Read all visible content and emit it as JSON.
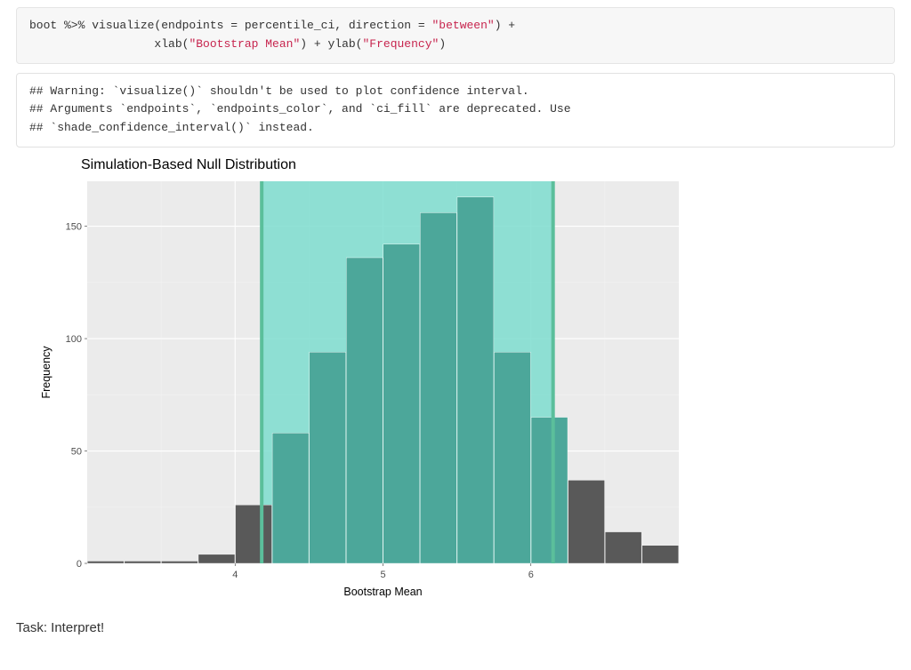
{
  "code": {
    "line1_a": "boot %>% visualize(endpoints = percentile_ci, direction = ",
    "line1_b": "\"between\"",
    "line1_c": ") +",
    "line2_a": "                  xlab(",
    "line2_b": "\"Bootstrap Mean\"",
    "line2_c": ") + ylab(",
    "line2_d": "\"Frequency\"",
    "line2_e": ")"
  },
  "warning": {
    "line1": "## Warning: `visualize()` shouldn't be used to plot confidence interval.",
    "line2": "## Arguments `endpoints`, `endpoints_color`, and `ci_fill` are deprecated. Use",
    "line3": "## `shade_confidence_interval()` instead."
  },
  "chart_data": {
    "type": "bar",
    "title": "Simulation-Based Null Distribution",
    "xlabel": "Bootstrap Mean",
    "ylabel": "Frequency",
    "x_ticks": [
      4,
      5,
      6
    ],
    "y_ticks": [
      0,
      50,
      100,
      150
    ],
    "xlim": [
      3.0,
      7.0
    ],
    "ylim": [
      0,
      170
    ],
    "ci": {
      "lower": 4.18,
      "upper": 6.15
    },
    "bin_width": 0.25,
    "bars": [
      {
        "x": 3.125,
        "count": 1
      },
      {
        "x": 3.375,
        "count": 1
      },
      {
        "x": 3.625,
        "count": 1
      },
      {
        "x": 3.875,
        "count": 4
      },
      {
        "x": 4.125,
        "count": 26
      },
      {
        "x": 4.375,
        "count": 58
      },
      {
        "x": 4.625,
        "count": 94
      },
      {
        "x": 4.875,
        "count": 136
      },
      {
        "x": 5.125,
        "count": 142
      },
      {
        "x": 5.375,
        "count": 156
      },
      {
        "x": 5.625,
        "count": 163
      },
      {
        "x": 5.875,
        "count": 94
      },
      {
        "x": 6.125,
        "count": 65
      },
      {
        "x": 6.375,
        "count": 37
      },
      {
        "x": 6.625,
        "count": 14
      },
      {
        "x": 6.875,
        "count": 8
      }
    ],
    "colors": {
      "panel_bg": "#ebebeb",
      "bar_outside": "#595959",
      "bar_inside": "#4ca79a",
      "ci_fill": "#7eddcf",
      "ci_line": "#5bbf9b",
      "grid_major": "#ffffff",
      "grid_minor": "#f3f3f3"
    }
  },
  "task_text": "Task: Interpret!"
}
